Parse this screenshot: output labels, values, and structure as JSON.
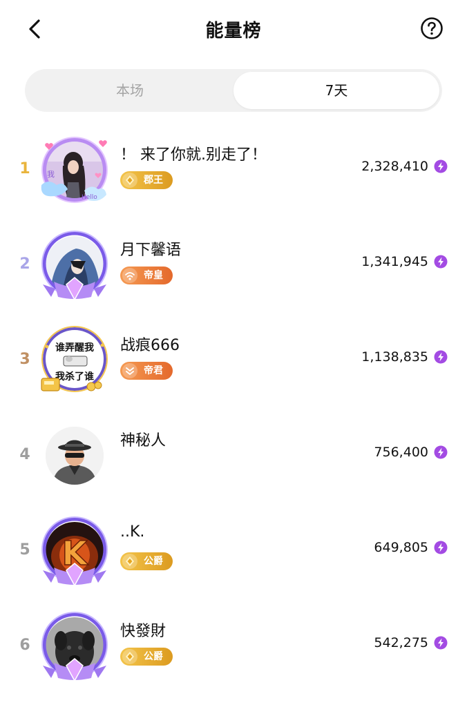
{
  "header": {
    "title": "能量榜"
  },
  "tabs": [
    {
      "label": "本场",
      "active": false
    },
    {
      "label": "7天",
      "active": true
    }
  ],
  "colors": {
    "rank1": "#e9b43c",
    "rank2": "#a9a5e8",
    "rank3": "#c09063",
    "rank_other": "#9e9e9e",
    "energy": "#a34be3",
    "badge_gold": "#e6a52a",
    "badge_orange": "#ea7433"
  },
  "ranking": [
    {
      "rank": "1",
      "name": "！ 来了你就.别走了！",
      "badge": "郡王",
      "score": "2,328,410",
      "badge_icon": "diamond-badge-icon"
    },
    {
      "rank": "2",
      "name": "月下馨语",
      "badge": "帝皇",
      "score": "1,341,945",
      "badge_icon": "wifi-crown-badge-icon"
    },
    {
      "rank": "3",
      "name": "战痕666",
      "badge": "帝君",
      "score": "1,138,835",
      "badge_icon": "chevron-badge-icon"
    },
    {
      "rank": "4",
      "name": "神秘人",
      "badge": "",
      "score": "756,400"
    },
    {
      "rank": "5",
      "name": "..K.",
      "badge": "公爵",
      "score": "649,805",
      "badge_icon": "diamond-badge-icon"
    },
    {
      "rank": "6",
      "name": "快發財",
      "badge": "公爵",
      "score": "542,275",
      "badge_icon": "diamond-badge-icon"
    }
  ],
  "avatar_images": {
    "row1": {
      "text_1": "我",
      "text_2": "Hello"
    },
    "row3": {
      "text_1": "谁弄醒我",
      "text_2": "我杀了谁"
    },
    "row5": {
      "text": "K"
    }
  }
}
